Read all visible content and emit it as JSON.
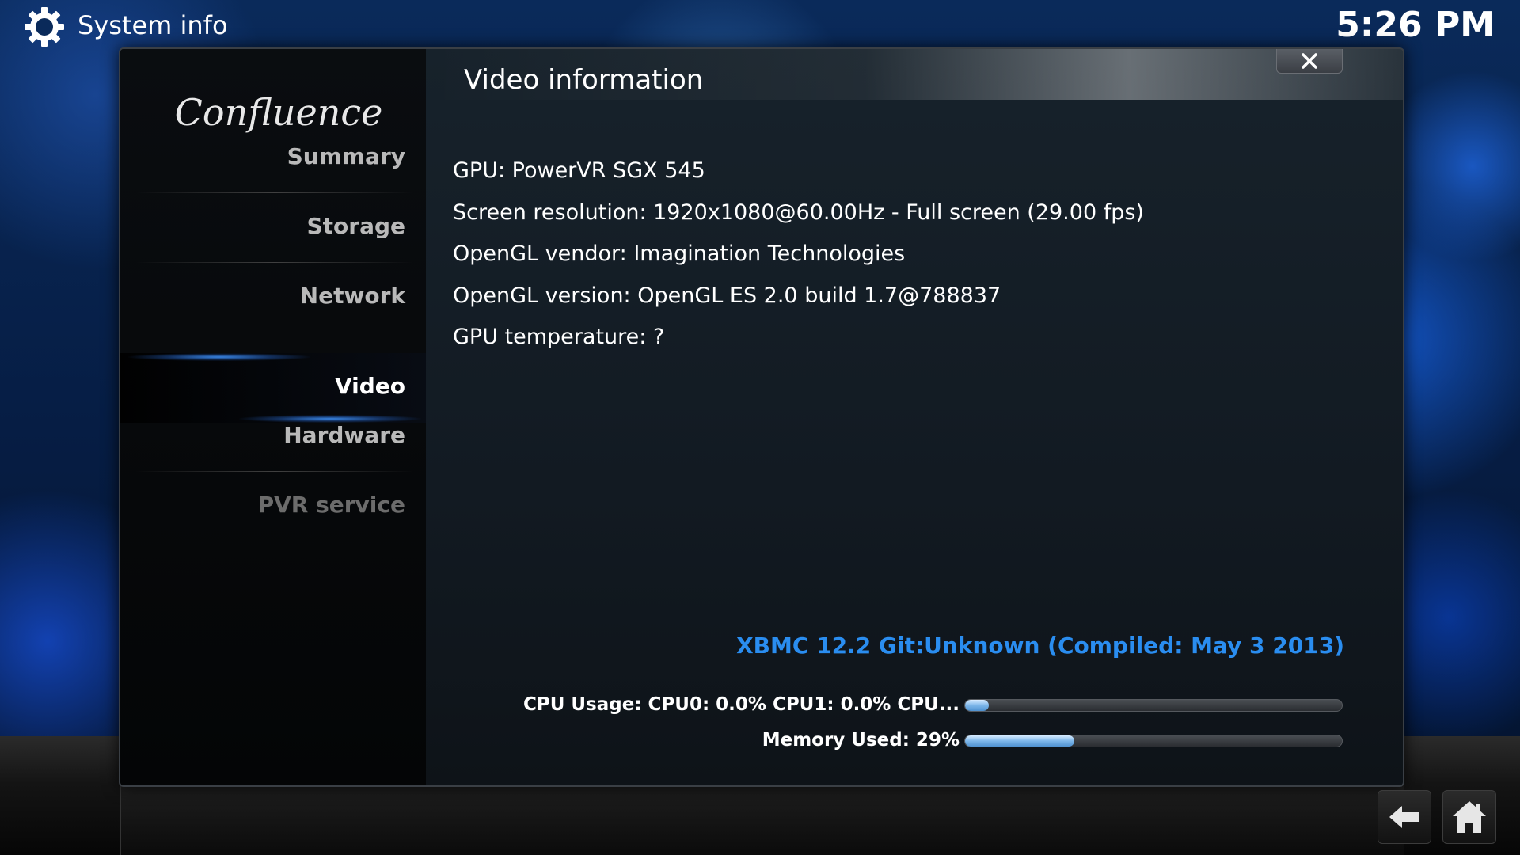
{
  "header": {
    "title": "System info",
    "clock": "5:26 PM",
    "icon": "gear-icon"
  },
  "sidebar": {
    "logo_text": "Confluence",
    "items": [
      {
        "label": "Summary",
        "state": "normal"
      },
      {
        "label": "Storage",
        "state": "normal"
      },
      {
        "label": "Network",
        "state": "normal"
      },
      {
        "label": "Video",
        "state": "active"
      },
      {
        "label": "Hardware",
        "state": "normal"
      },
      {
        "label": "PVR service",
        "state": "disabled"
      }
    ]
  },
  "content": {
    "title": "Video information",
    "lines": [
      "GPU: PowerVR SGX 545",
      "Screen resolution: 1920x1080@60.00Hz - Full screen (29.00 fps)",
      "OpenGL vendor: Imagination Technologies",
      "OpenGL version: OpenGL ES 2.0 build 1.7@788837",
      "GPU temperature: ?"
    ],
    "version": "XBMC 12.2 Git:Unknown (Compiled: May  3 2013)",
    "cpu": {
      "label": "CPU Usage: CPU0: 0.0% CPU1: 0.0% CPU...",
      "percent": 0
    },
    "memory": {
      "label": "Memory Used: 29%",
      "percent": 29
    }
  },
  "dialog": {
    "close_icon": "close-icon"
  },
  "footer": {
    "back_icon": "back-arrow-icon",
    "home_icon": "home-icon"
  },
  "colors": {
    "accent_blue": "#2a8df0",
    "text_white": "#ffffff",
    "menu_inactive": "#b9b9b9",
    "menu_disabled": "#6c6c6c"
  }
}
